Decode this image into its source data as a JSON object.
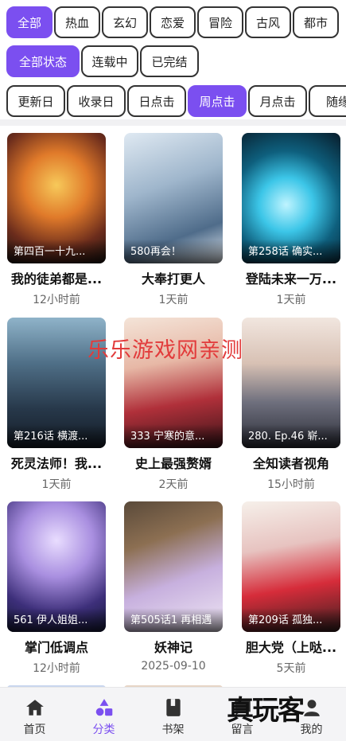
{
  "genre_filters": [
    "全部",
    "热血",
    "玄幻",
    "恋爱",
    "冒险",
    "古风",
    "都市"
  ],
  "status_filters": [
    "全部状态",
    "连载中",
    "已完结"
  ],
  "sort_filters": [
    "更新日",
    "收录日",
    "日点击",
    "周点击",
    "月点击",
    "随缘"
  ],
  "active": {
    "genre": "全部",
    "status": "全部状态",
    "sort": "周点击",
    "tab": "分类"
  },
  "comics": [
    {
      "caption": "第四百一十九...",
      "title": "我的徒弟都是...",
      "time": "12小时前"
    },
    {
      "caption": "580再会！",
      "title": "大奉打更人",
      "time": "1天前"
    },
    {
      "caption": "第258话 确实...",
      "title": "登陆未来一万...",
      "time": "1天前"
    },
    {
      "caption": "第216话 横渡...",
      "title": "死灵法师！我...",
      "time": "1天前"
    },
    {
      "caption": "333 宁寒的意...",
      "title": "史上最强赘婿",
      "time": "2天前"
    },
    {
      "caption": "280. Ep.46 崭...",
      "title": "全知读者视角",
      "time": "15小时前"
    },
    {
      "caption": "561 伊人姐姐...",
      "title": "掌门低调点",
      "time": "12小时前"
    },
    {
      "caption": "第505话1 再相遇",
      "title": "妖神记",
      "time": "2025-09-10"
    },
    {
      "caption": "第209话 孤独...",
      "title": "胆大党（上哒...",
      "time": "5天前"
    }
  ],
  "watermark": "乐乐游戏网亲测",
  "brand_logo": "真玩客",
  "tabs": [
    {
      "label": "首页",
      "icon": "home-icon"
    },
    {
      "label": "分类",
      "icon": "category-icon"
    },
    {
      "label": "书架",
      "icon": "bookshelf-icon"
    },
    {
      "label": "留言",
      "icon": "message-icon"
    },
    {
      "label": "我的",
      "icon": "profile-icon"
    }
  ],
  "colors": {
    "accent": "#7b4ff0",
    "watermark": "#e23b3b",
    "tabbar_bg": "#f4f4f6"
  }
}
